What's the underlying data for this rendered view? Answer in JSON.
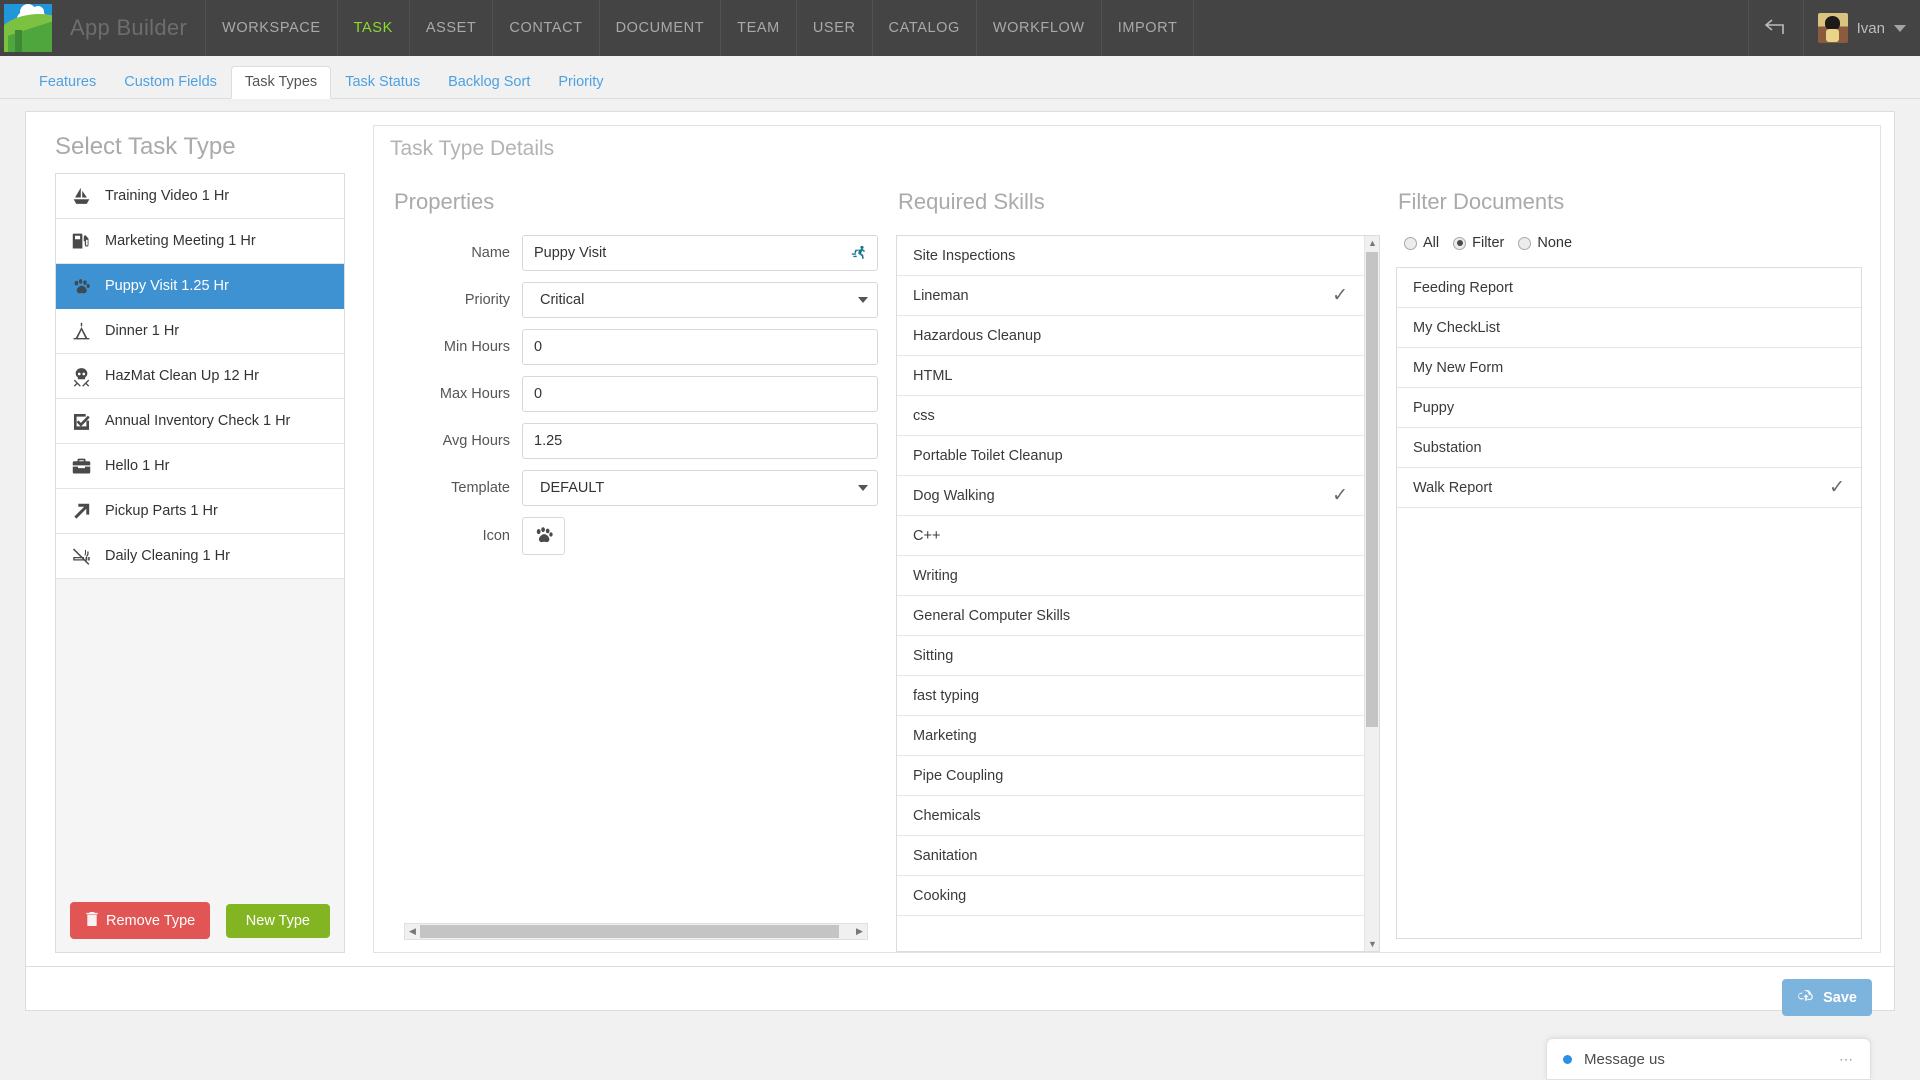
{
  "topnav": {
    "brand": "App Builder",
    "items": [
      {
        "label": "WORKSPACE",
        "active": false
      },
      {
        "label": "TASK",
        "active": true
      },
      {
        "label": "ASSET",
        "active": false
      },
      {
        "label": "CONTACT",
        "active": false
      },
      {
        "label": "DOCUMENT",
        "active": false
      },
      {
        "label": "TEAM",
        "active": false
      },
      {
        "label": "USER",
        "active": false
      },
      {
        "label": "CATALOG",
        "active": false
      },
      {
        "label": "WORKFLOW",
        "active": false
      },
      {
        "label": "IMPORT",
        "active": false
      }
    ],
    "back_icon": "back-arrow-icon",
    "user_name": "Ivan",
    "accent_active": "#8ddc2d",
    "bar_color": "#444444"
  },
  "subtabs": [
    {
      "label": "Features",
      "active": false
    },
    {
      "label": "Custom Fields",
      "active": false
    },
    {
      "label": "Task Types",
      "active": true
    },
    {
      "label": "Task Status",
      "active": false
    },
    {
      "label": "Backlog Sort",
      "active": false
    },
    {
      "label": "Priority",
      "active": false
    }
  ],
  "left_panel": {
    "title": "Select Task Type",
    "items": [
      {
        "label": "Training Video 1 Hr",
        "icon": "sailboat-icon",
        "selected": false
      },
      {
        "label": "Marketing Meeting 1 Hr",
        "icon": "fuel-pump-icon",
        "selected": false
      },
      {
        "label": "Puppy Visit 1.25 Hr",
        "icon": "paw-print-icon",
        "selected": true
      },
      {
        "label": "Dinner 1 Hr",
        "icon": "teepee-icon",
        "selected": false
      },
      {
        "label": "HazMat Clean Up 12 Hr",
        "icon": "skull-crossbones-icon",
        "selected": false
      },
      {
        "label": "Annual Inventory Check 1 Hr",
        "icon": "checkbox-checked-icon",
        "selected": false
      },
      {
        "label": "Hello 1 Hr",
        "icon": "toolbox-icon",
        "selected": false
      },
      {
        "label": "Pickup Parts 1 Hr",
        "icon": "arrow-up-right-icon",
        "selected": false
      },
      {
        "label": "Daily Cleaning 1 Hr",
        "icon": "no-smoking-icon",
        "selected": false
      }
    ],
    "remove_button": "Remove Type",
    "new_button": "New Type",
    "remove_color": "#e15554",
    "new_color": "#82b521",
    "selected_color": "#3f92d2"
  },
  "details": {
    "header": "Task Type Details",
    "properties": {
      "title": "Properties",
      "fields": [
        {
          "label": "Name",
          "value": "Puppy Visit",
          "type": "text",
          "badge": "runner-icon"
        },
        {
          "label": "Priority",
          "value": "Critical",
          "type": "select"
        },
        {
          "label": "Min Hours",
          "value": "0",
          "type": "text"
        },
        {
          "label": "Max Hours",
          "value": "0",
          "type": "text"
        },
        {
          "label": "Avg Hours",
          "value": "1.25",
          "type": "text"
        },
        {
          "label": "Template",
          "value": "DEFAULT",
          "type": "select"
        }
      ],
      "icon_label": "Icon",
      "icon_value": "paw-print-icon"
    },
    "required_skills": {
      "title": "Required Skills",
      "items": [
        {
          "label": "Site Inspections",
          "checked": false
        },
        {
          "label": "Lineman",
          "checked": true
        },
        {
          "label": "Hazardous Cleanup",
          "checked": false
        },
        {
          "label": "HTML",
          "checked": false
        },
        {
          "label": "css",
          "checked": false
        },
        {
          "label": "Portable Toilet Cleanup",
          "checked": false
        },
        {
          "label": "Dog Walking",
          "checked": true
        },
        {
          "label": "C++",
          "checked": false
        },
        {
          "label": "Writing",
          "checked": false
        },
        {
          "label": "General Computer Skills",
          "checked": false
        },
        {
          "label": "Sitting",
          "checked": false
        },
        {
          "label": "fast typing",
          "checked": false
        },
        {
          "label": "Marketing",
          "checked": false
        },
        {
          "label": "Pipe Coupling",
          "checked": false
        },
        {
          "label": "Chemicals",
          "checked": false
        },
        {
          "label": "Sanitation",
          "checked": false
        },
        {
          "label": "Cooking",
          "checked": false
        }
      ]
    },
    "filter_documents": {
      "title": "Filter Documents",
      "radios": [
        {
          "label": "All",
          "checked": false
        },
        {
          "label": "Filter",
          "checked": true
        },
        {
          "label": "None",
          "checked": false
        }
      ],
      "items": [
        {
          "label": "Feeding Report",
          "checked": false
        },
        {
          "label": "My CheckList",
          "checked": false
        },
        {
          "label": "My New Form",
          "checked": false
        },
        {
          "label": "Puppy",
          "checked": false
        },
        {
          "label": "Substation",
          "checked": false
        },
        {
          "label": "Walk Report",
          "checked": true
        }
      ]
    }
  },
  "footer": {
    "save_label": "Save",
    "save_icon": "cloud-upload-icon",
    "save_color": "#7db4dd"
  },
  "chat": {
    "label": "Message us",
    "more": "⋯",
    "dot_color": "#2b8fe3"
  }
}
